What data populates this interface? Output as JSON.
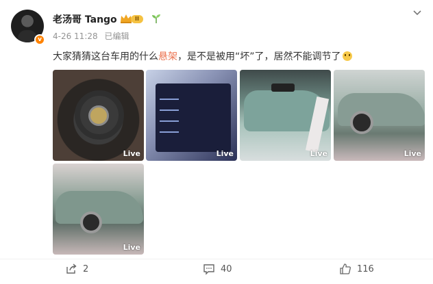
{
  "post": {
    "username": "老汤哥 Tango",
    "vip_level": "II",
    "timestamp": "4-26 11:28",
    "edited_label": "已编辑",
    "text_before": "大家猜猜这台车用的什么",
    "text_highlight": "悬架",
    "text_after": "，是不是被用“坏”了，居然不能调节了",
    "images": [
      {
        "badge": "Live"
      },
      {
        "badge": "Live"
      },
      {
        "badge": "Live"
      },
      {
        "badge": "Live"
      },
      {
        "badge": "Live"
      }
    ]
  },
  "actions": {
    "share_count": "2",
    "comment_count": "40",
    "like_count": "116"
  },
  "colors": {
    "highlight": "#eb7350",
    "verified": "#ff8200",
    "vip": "#f5c242"
  },
  "icons": [
    "verified-icon",
    "crown-icon",
    "vip-badge-icon",
    "sprout-icon",
    "chevron-down-icon",
    "share-icon",
    "comment-icon",
    "like-icon"
  ]
}
